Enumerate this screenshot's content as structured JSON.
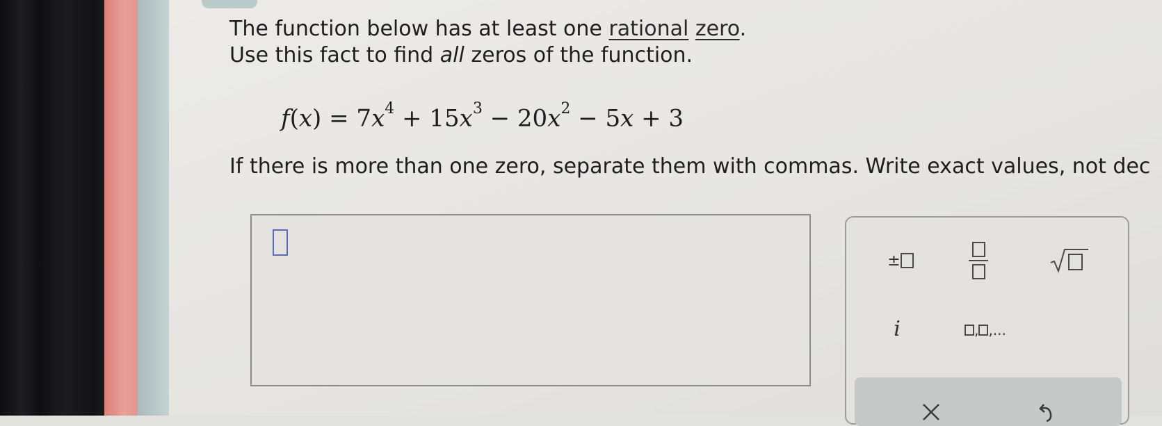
{
  "question": {
    "line1_prefix": "The function below has at least one",
    "link_rational": "rational",
    "link_zero": "zero",
    "line1_suffix": ".",
    "line2_prefix": "Use this fact to find",
    "line2_emph": "all",
    "line2_suffix": "zeros of the function.",
    "instructions": "If there is more than one zero, separate them with commas. Write exact values, not dec"
  },
  "formula": {
    "fname": "f",
    "var": "x",
    "t1_coef": "7",
    "t1_exp": "4",
    "t2_coef": "+ 15",
    "t2_exp": "3",
    "t3_coef": "− 20",
    "t3_exp": "2",
    "t4": "− 5",
    "t5": "+ 3"
  },
  "palette": {
    "plus_minus": "±",
    "imag": "i",
    "list_sep": ",",
    "list_ellipsis": ",..."
  },
  "icons": [
    "plus-minus-icon",
    "fraction-icon",
    "square-root-icon",
    "imaginary-unit-icon",
    "list-icon",
    "clear-x-icon",
    "undo-icon"
  ]
}
